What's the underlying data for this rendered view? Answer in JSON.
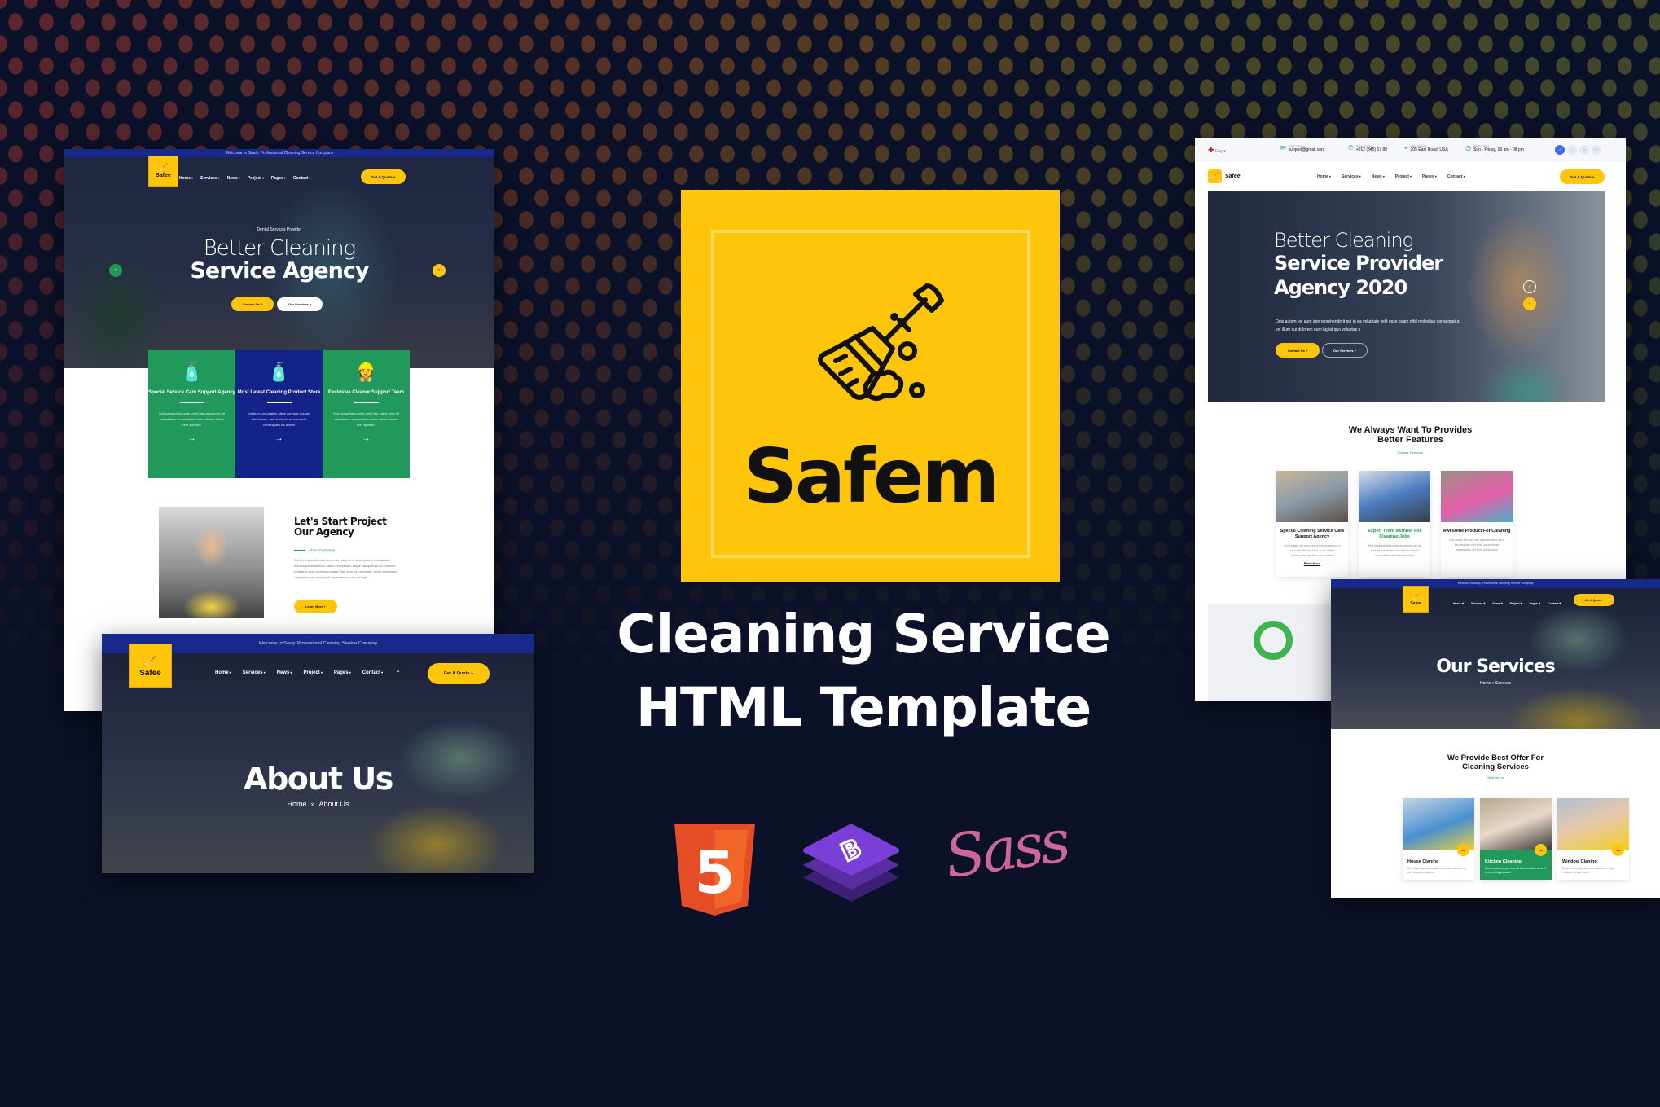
{
  "colors": {
    "background": "#0b1128",
    "brand_yellow": "#ffc50b",
    "brand_green": "#20995a",
    "brand_blue": "#172a8c"
  },
  "nav_items": [
    "Home",
    "Services",
    "News",
    "Project",
    "Pages",
    "Contact"
  ],
  "center": {
    "logo_name": "Safem",
    "logo_icon": "broom-icon",
    "headline_line1": "Cleaning Service",
    "headline_line2": "HTML Template",
    "tech_icons": [
      {
        "name": "html5-icon",
        "label": "5"
      },
      {
        "name": "bootstrap-icon",
        "label": "B"
      },
      {
        "name": "sass-icon",
        "label": "Sass"
      }
    ]
  },
  "home_dark": {
    "topbar": "Welcome to Saafy. Professional Cleaning Service Company",
    "logo": "Safee",
    "quote_button": "Get A Quote +",
    "pretitle": "Dental Services Provider",
    "title_light": "Better Cleaning",
    "title_bold": "Service Agency",
    "contact_button": "Contact Us +",
    "services_button": "Our Services +",
    "features": [
      {
        "title": "Special Service Care Support Agency",
        "text": "Sed perspiciatis unde omni iste natus error sit voluptatem accusantium dolor udalum totam rem aperiam"
      },
      {
        "title": "Most Latest Cleaning Product Store",
        "text": "Vostrum exercitation ullam corporis suscipit laboriosam, nisi ut aliquid ex commodi consequatu sis autem"
      },
      {
        "title": "Exclusive Cleaner Support Team",
        "text": "Sed perspiciatis unde omni iste natus error sit voluptatem accusantium dolor udalum totam rem aperiam"
      }
    ],
    "about_title": "Let's Start Project Our Agency",
    "about_tag": "About Company",
    "about_text": "Sed ut perspiciatis unde omnis iste natus error sit voluptatem accusantium doloremque laudantium, totam rem aperiam, eaque ipsa quae ab illo inventore veritatis et quasi architecto beatae vitae dicta sunt explicabo. Nemo enim ipsam voluptatem quia voluptas sit aspernatur aut odit aut fugit",
    "learn_more": "Learn More +"
  },
  "about_page": {
    "topbar": "Welcome to Saafy. Professional Cleaning Service Comapny",
    "logo": "Safee",
    "quote_button": "Get A Quote +",
    "title": "About Us",
    "breadcrumb": [
      "Home",
      "»",
      "About Us"
    ]
  },
  "home_light": {
    "language": "Eng",
    "email_label": "Email Address",
    "email": "support@gmail.com",
    "phone_label": "Phone Number",
    "phone": "+012 (345) 67 89",
    "office_label": "Office Address",
    "office": "205 East Road, USA",
    "hours_label": "Working Hours",
    "hours": "Sun - Friday, 09 am - 08 pm",
    "social": [
      "f",
      "t",
      "in",
      "G+"
    ],
    "logo": "Safee",
    "quote_button": "Get A Quote +",
    "title_light": "Better Cleaning",
    "title_bold1": "Service Provider",
    "title_bold2": "Agency 2020",
    "text": "Quis autem vel eum iure reprehenderit qui in ea voluptate velit esse quam nihil molestiae consequatur, vel illum qui dolorem eum fugiat quo voluptas n",
    "contact_button": "Contact Us +",
    "services_button": "Our Services +",
    "features_title1": "We Always Want To Provides",
    "features_title2": "Better Features",
    "features_tag": "Explore Features",
    "cards": [
      {
        "title": "Special Cleaning Service Care Support Agency",
        "text": "Quis autem vel eum iure reprehenderit qui in ea voluptate velit esse quamnihilae consequatur vel illum qui dolorem"
      },
      {
        "title": "Expert Team Member For Cleaning Jobs",
        "text": "Sed ut perspiciatis unde omnis iste nat us error sit voluptatem accusantiu emque laudantium totam rem aperiam"
      },
      {
        "title": "Awesome Product For Cleaning",
        "text": "Luis autem vel eum iure reprehenderit qui in ea voluptate velit esse quamnihilae consequatur vel illum qui dolorem"
      }
    ],
    "read_more": "Read More"
  },
  "services_page": {
    "topbar": "Welcome to Saafy. Professional Cleaning Service Company",
    "logo": "Safee",
    "quote_button": "Get A Quote +",
    "title": "Our Services",
    "breadcrumb": [
      "Home",
      "»",
      "Services"
    ],
    "section_title1": "We Provide Best Offer For",
    "section_title2": "Cleaning Services",
    "section_tag": "What We Do",
    "cards": [
      {
        "title": "House Claning",
        "text": "Sed ut perspiciatis unde omnis iste natus error sit voluptatem accus"
      },
      {
        "title": "Kitchen Cleaning",
        "text": "Must explain to you how all this mistaken idea of denouncing pleasure"
      },
      {
        "title": "Window Claning",
        "text": "Dolores eos qui ratione voluptatem sequi nesciunt neque porro"
      }
    ]
  }
}
